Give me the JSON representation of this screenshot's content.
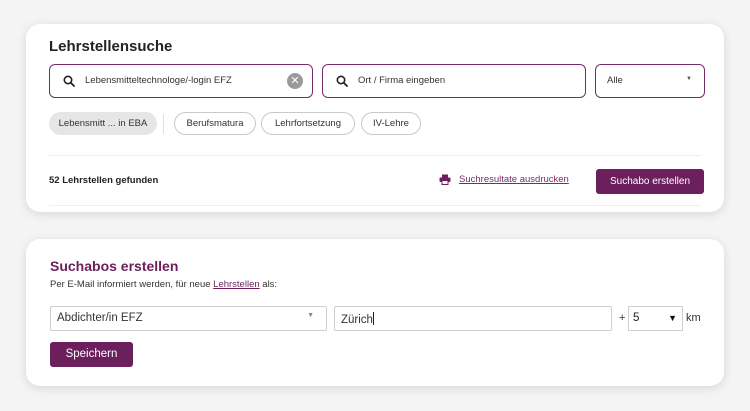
{
  "search": {
    "title": "Lehrstellensuche",
    "profession_value": "Lebensmitteltechnologe/-login EFZ",
    "location_placeholder": "Ort / Firma eingeben",
    "filter_select": "Alle",
    "chips": [
      "Lebensmitt ... in EBA",
      "Berufsmatura",
      "Lehrfortsetzung",
      "IV-Lehre"
    ],
    "results_count": "52 Lehrstellen gefunden",
    "print_link": "Suchresultate ausdrucken",
    "create_abo_button": "Suchabo erstellen"
  },
  "abo": {
    "title": "Suchabos erstellen",
    "subtitle_prefix": "Per E-Mail informiert werden, für neue ",
    "subtitle_link": "Lehrstellen",
    "subtitle_suffix": " als:",
    "profession_value": "Abdichter/in EFZ",
    "location_value": "Zürich",
    "plus": "+",
    "radius_value": "5",
    "radius_unit": "km",
    "save_button": "Speichern"
  },
  "colors": {
    "accent": "#6b1f5c",
    "border_accent": "#7a2a6c",
    "chip_active_bg": "#e6e6e6"
  },
  "icons": {
    "search": "magnifier",
    "clear": "x-circle",
    "print": "printer",
    "dropdown": "caret-down"
  }
}
